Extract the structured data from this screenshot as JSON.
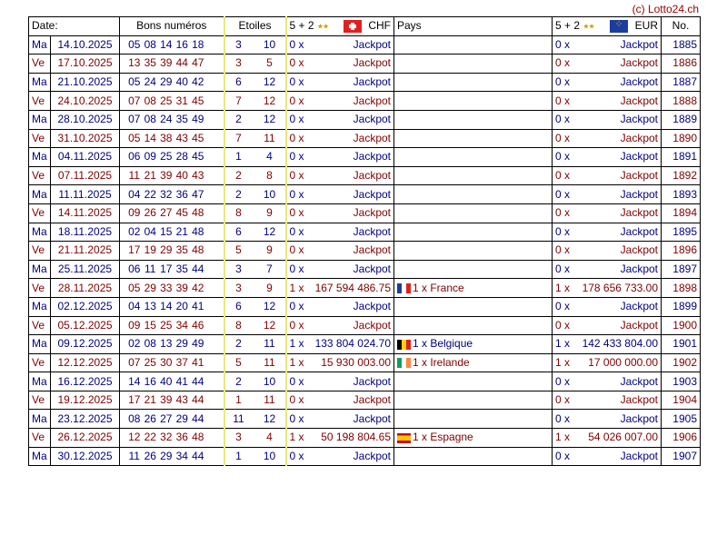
{
  "credit": "(c) Lotto24.ch",
  "header": {
    "date": "Date:",
    "numbers": "Bons numéros",
    "stars": "Etoiles",
    "chf_prefix": "5 + 2",
    "chf_currency": "CHF",
    "country": "Pays",
    "eur_prefix": "5 + 2",
    "eur_currency": "EUR",
    "no": "No."
  },
  "rows": [
    {
      "day": "Ma",
      "date": "14.10.2025",
      "nums": [
        "05",
        "08",
        "14",
        "16",
        "18"
      ],
      "stars": [
        "3",
        "10"
      ],
      "chf_count": "0 x",
      "chf_amount": "Jackpot",
      "country": "",
      "flag": "",
      "eur_count": "0 x",
      "eur_amount": "Jackpot",
      "no": "1885"
    },
    {
      "day": "Ve",
      "date": "17.10.2025",
      "nums": [
        "13",
        "35",
        "39",
        "44",
        "47"
      ],
      "stars": [
        "3",
        "5"
      ],
      "chf_count": "0 x",
      "chf_amount": "Jackpot",
      "country": "",
      "flag": "",
      "eur_count": "0 x",
      "eur_amount": "Jackpot",
      "no": "1886"
    },
    {
      "day": "Ma",
      "date": "21.10.2025",
      "nums": [
        "05",
        "24",
        "29",
        "40",
        "42"
      ],
      "stars": [
        "6",
        "12"
      ],
      "chf_count": "0 x",
      "chf_amount": "Jackpot",
      "country": "",
      "flag": "",
      "eur_count": "0 x",
      "eur_amount": "Jackpot",
      "no": "1887"
    },
    {
      "day": "Ve",
      "date": "24.10.2025",
      "nums": [
        "07",
        "08",
        "25",
        "31",
        "45"
      ],
      "stars": [
        "7",
        "12"
      ],
      "chf_count": "0 x",
      "chf_amount": "Jackpot",
      "country": "",
      "flag": "",
      "eur_count": "0 x",
      "eur_amount": "Jackpot",
      "no": "1888"
    },
    {
      "day": "Ma",
      "date": "28.10.2025",
      "nums": [
        "07",
        "08",
        "24",
        "35",
        "49"
      ],
      "stars": [
        "2",
        "12"
      ],
      "chf_count": "0 x",
      "chf_amount": "Jackpot",
      "country": "",
      "flag": "",
      "eur_count": "0 x",
      "eur_amount": "Jackpot",
      "no": "1889"
    },
    {
      "day": "Ve",
      "date": "31.10.2025",
      "nums": [
        "05",
        "14",
        "38",
        "43",
        "45"
      ],
      "stars": [
        "7",
        "11"
      ],
      "chf_count": "0 x",
      "chf_amount": "Jackpot",
      "country": "",
      "flag": "",
      "eur_count": "0 x",
      "eur_amount": "Jackpot",
      "no": "1890"
    },
    {
      "day": "Ma",
      "date": "04.11.2025",
      "nums": [
        "06",
        "09",
        "25",
        "28",
        "45"
      ],
      "stars": [
        "1",
        "4"
      ],
      "chf_count": "0 x",
      "chf_amount": "Jackpot",
      "country": "",
      "flag": "",
      "eur_count": "0 x",
      "eur_amount": "Jackpot",
      "no": "1891"
    },
    {
      "day": "Ve",
      "date": "07.11.2025",
      "nums": [
        "11",
        "21",
        "39",
        "40",
        "43"
      ],
      "stars": [
        "2",
        "8"
      ],
      "chf_count": "0 x",
      "chf_amount": "Jackpot",
      "country": "",
      "flag": "",
      "eur_count": "0 x",
      "eur_amount": "Jackpot",
      "no": "1892"
    },
    {
      "day": "Ma",
      "date": "11.11.2025",
      "nums": [
        "04",
        "22",
        "32",
        "36",
        "47"
      ],
      "stars": [
        "2",
        "10"
      ],
      "chf_count": "0 x",
      "chf_amount": "Jackpot",
      "country": "",
      "flag": "",
      "eur_count": "0 x",
      "eur_amount": "Jackpot",
      "no": "1893"
    },
    {
      "day": "Ve",
      "date": "14.11.2025",
      "nums": [
        "09",
        "26",
        "27",
        "45",
        "48"
      ],
      "stars": [
        "8",
        "9"
      ],
      "chf_count": "0 x",
      "chf_amount": "Jackpot",
      "country": "",
      "flag": "",
      "eur_count": "0 x",
      "eur_amount": "Jackpot",
      "no": "1894"
    },
    {
      "day": "Ma",
      "date": "18.11.2025",
      "nums": [
        "02",
        "04",
        "15",
        "21",
        "48"
      ],
      "stars": [
        "6",
        "12"
      ],
      "chf_count": "0 x",
      "chf_amount": "Jackpot",
      "country": "",
      "flag": "",
      "eur_count": "0 x",
      "eur_amount": "Jackpot",
      "no": "1895"
    },
    {
      "day": "Ve",
      "date": "21.11.2025",
      "nums": [
        "17",
        "19",
        "29",
        "35",
        "48"
      ],
      "stars": [
        "5",
        "9"
      ],
      "chf_count": "0 x",
      "chf_amount": "Jackpot",
      "country": "",
      "flag": "",
      "eur_count": "0 x",
      "eur_amount": "Jackpot",
      "no": "1896"
    },
    {
      "day": "Ma",
      "date": "25.11.2025",
      "nums": [
        "06",
        "11",
        "17",
        "35",
        "44"
      ],
      "stars": [
        "3",
        "7"
      ],
      "chf_count": "0 x",
      "chf_amount": "Jackpot",
      "country": "",
      "flag": "",
      "eur_count": "0 x",
      "eur_amount": "Jackpot",
      "no": "1897"
    },
    {
      "day": "Ve",
      "date": "28.11.2025",
      "nums": [
        "05",
        "29",
        "33",
        "39",
        "42"
      ],
      "stars": [
        "3",
        "9"
      ],
      "chf_count": "1 x",
      "chf_amount": "167 594 486.75",
      "country": "1 x France",
      "flag": "fr",
      "eur_count": "1 x",
      "eur_amount": "178 656 733.00",
      "no": "1898"
    },
    {
      "day": "Ma",
      "date": "02.12.2025",
      "nums": [
        "04",
        "13",
        "14",
        "20",
        "41"
      ],
      "stars": [
        "6",
        "12"
      ],
      "chf_count": "0 x",
      "chf_amount": "Jackpot",
      "country": "",
      "flag": "",
      "eur_count": "0 x",
      "eur_amount": "Jackpot",
      "no": "1899"
    },
    {
      "day": "Ve",
      "date": "05.12.2025",
      "nums": [
        "09",
        "15",
        "25",
        "34",
        "46"
      ],
      "stars": [
        "8",
        "12"
      ],
      "chf_count": "0 x",
      "chf_amount": "Jackpot",
      "country": "",
      "flag": "",
      "eur_count": "0 x",
      "eur_amount": "Jackpot",
      "no": "1900"
    },
    {
      "day": "Ma",
      "date": "09.12.2025",
      "nums": [
        "02",
        "08",
        "13",
        "29",
        "49"
      ],
      "stars": [
        "2",
        "11"
      ],
      "chf_count": "1 x",
      "chf_amount": "133 804 024.70",
      "country": "1 x Belgique",
      "flag": "be",
      "eur_count": "1 x",
      "eur_amount": "142 433 804.00",
      "no": "1901"
    },
    {
      "day": "Ve",
      "date": "12.12.2025",
      "nums": [
        "07",
        "25",
        "30",
        "37",
        "41"
      ],
      "stars": [
        "5",
        "11"
      ],
      "chf_count": "1 x",
      "chf_amount": "15 930 003.00",
      "country": "1 x Irelande",
      "flag": "ie",
      "eur_count": "1 x",
      "eur_amount": "17 000 000.00",
      "no": "1902"
    },
    {
      "day": "Ma",
      "date": "16.12.2025",
      "nums": [
        "14",
        "16",
        "40",
        "41",
        "44"
      ],
      "stars": [
        "2",
        "10"
      ],
      "chf_count": "0 x",
      "chf_amount": "Jackpot",
      "country": "",
      "flag": "",
      "eur_count": "0 x",
      "eur_amount": "Jackpot",
      "no": "1903"
    },
    {
      "day": "Ve",
      "date": "19.12.2025",
      "nums": [
        "17",
        "21",
        "39",
        "43",
        "44"
      ],
      "stars": [
        "1",
        "11"
      ],
      "chf_count": "0 x",
      "chf_amount": "Jackpot",
      "country": "",
      "flag": "",
      "eur_count": "0 x",
      "eur_amount": "Jackpot",
      "no": "1904"
    },
    {
      "day": "Ma",
      "date": "23.12.2025",
      "nums": [
        "08",
        "26",
        "27",
        "29",
        "44"
      ],
      "stars": [
        "11",
        "12"
      ],
      "chf_count": "0 x",
      "chf_amount": "Jackpot",
      "country": "",
      "flag": "",
      "eur_count": "0 x",
      "eur_amount": "Jackpot",
      "no": "1905"
    },
    {
      "day": "Ve",
      "date": "26.12.2025",
      "nums": [
        "12",
        "22",
        "32",
        "36",
        "48"
      ],
      "stars": [
        "3",
        "4"
      ],
      "chf_count": "1 x",
      "chf_amount": "50 198 804.65",
      "country": "1 x Espagne",
      "flag": "es",
      "eur_count": "1 x",
      "eur_amount": "54 026 007.00",
      "no": "1906"
    },
    {
      "day": "Ma",
      "date": "30.12.2025",
      "nums": [
        "11",
        "26",
        "29",
        "34",
        "44"
      ],
      "stars": [
        "1",
        "10"
      ],
      "chf_count": "0 x",
      "chf_amount": "Jackpot",
      "country": "",
      "flag": "",
      "eur_count": "0 x",
      "eur_amount": "Jackpot",
      "no": "1907"
    }
  ]
}
